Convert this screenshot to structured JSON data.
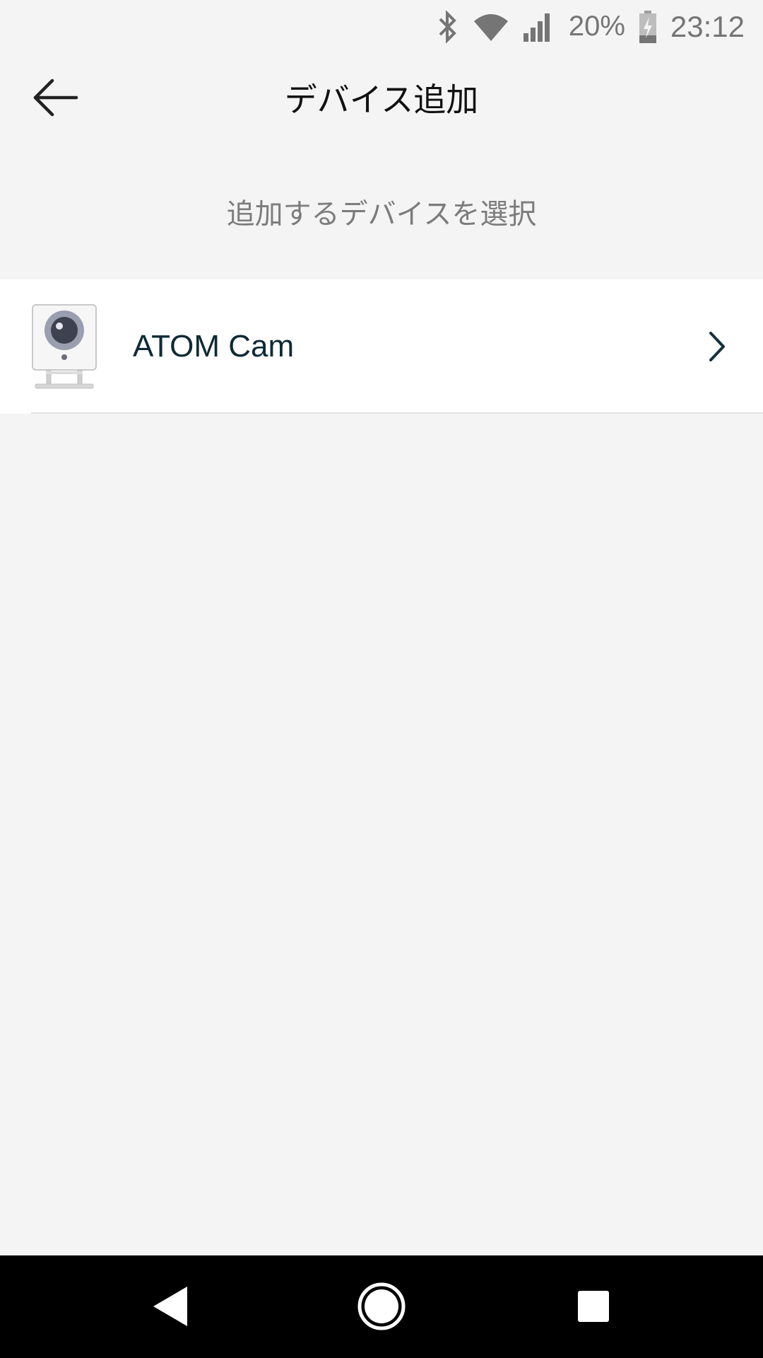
{
  "status_bar": {
    "battery_percent": "20%",
    "time": "23:12"
  },
  "app_bar": {
    "title": "デバイス追加"
  },
  "subtitle": "追加するデバイスを選択",
  "devices": [
    {
      "name": "ATOM Cam",
      "icon": "camera-device-icon"
    }
  ],
  "colors": {
    "background": "#f4f4f4",
    "card": "#ffffff",
    "device_text": "#0f2a36",
    "subtitle_text": "#7c7c7c",
    "nav_bar": "#000000"
  }
}
